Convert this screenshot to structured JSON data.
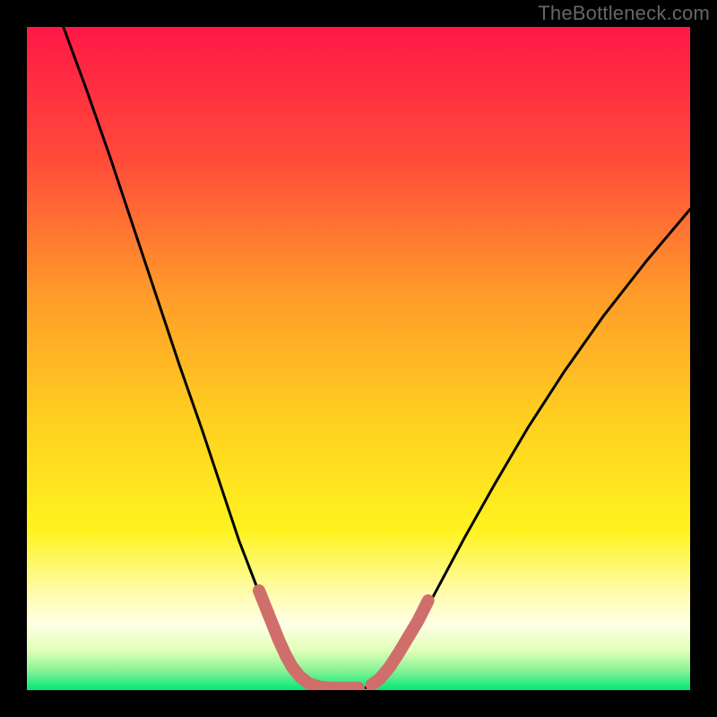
{
  "watermark": "TheBottleneck.com",
  "chart_data": {
    "type": "line",
    "title": "",
    "xlabel": "",
    "ylabel": "",
    "xlim": [
      0,
      1
    ],
    "ylim": [
      0,
      1
    ],
    "gradient_colors": {
      "top": "#ff1846",
      "upper_mid": "#ff8a2a",
      "mid": "#ffe81f",
      "lower_mid": "#f8fe90",
      "band_pale": "#ffffe6",
      "bottom": "#00e878"
    },
    "series": [
      {
        "name": "bottleneck-curve",
        "stroke": "#000000",
        "stroke_width": 3,
        "points": [
          {
            "x": 0.055,
            "y": 1.0
          },
          {
            "x": 0.09,
            "y": 0.905
          },
          {
            "x": 0.125,
            "y": 0.805
          },
          {
            "x": 0.16,
            "y": 0.7
          },
          {
            "x": 0.195,
            "y": 0.595
          },
          {
            "x": 0.23,
            "y": 0.49
          },
          {
            "x": 0.265,
            "y": 0.39
          },
          {
            "x": 0.295,
            "y": 0.3
          },
          {
            "x": 0.32,
            "y": 0.225
          },
          {
            "x": 0.345,
            "y": 0.16
          },
          {
            "x": 0.365,
            "y": 0.105
          },
          {
            "x": 0.382,
            "y": 0.062
          },
          {
            "x": 0.398,
            "y": 0.032
          },
          {
            "x": 0.415,
            "y": 0.012
          },
          {
            "x": 0.435,
            "y": 0.004
          },
          {
            "x": 0.46,
            "y": 0.002
          },
          {
            "x": 0.49,
            "y": 0.002
          },
          {
            "x": 0.515,
            "y": 0.004
          },
          {
            "x": 0.533,
            "y": 0.014
          },
          {
            "x": 0.555,
            "y": 0.04
          },
          {
            "x": 0.585,
            "y": 0.09
          },
          {
            "x": 0.62,
            "y": 0.155
          },
          {
            "x": 0.66,
            "y": 0.23
          },
          {
            "x": 0.705,
            "y": 0.31
          },
          {
            "x": 0.755,
            "y": 0.395
          },
          {
            "x": 0.81,
            "y": 0.48
          },
          {
            "x": 0.87,
            "y": 0.565
          },
          {
            "x": 0.935,
            "y": 0.648
          },
          {
            "x": 1.0,
            "y": 0.725
          }
        ]
      },
      {
        "name": "highlight-markers-left",
        "stroke": "#cf6e6b",
        "marker_radius": 7,
        "points": [
          {
            "x": 0.35,
            "y": 0.15
          },
          {
            "x": 0.36,
            "y": 0.125
          },
          {
            "x": 0.37,
            "y": 0.1
          },
          {
            "x": 0.38,
            "y": 0.075
          },
          {
            "x": 0.39,
            "y": 0.053
          },
          {
            "x": 0.4,
            "y": 0.035
          },
          {
            "x": 0.412,
            "y": 0.02
          },
          {
            "x": 0.425,
            "y": 0.01
          },
          {
            "x": 0.44,
            "y": 0.005
          },
          {
            "x": 0.46,
            "y": 0.003
          },
          {
            "x": 0.48,
            "y": 0.003
          },
          {
            "x": 0.5,
            "y": 0.003
          }
        ]
      },
      {
        "name": "highlight-markers-right",
        "stroke": "#cf6e6b",
        "marker_radius": 7,
        "points": [
          {
            "x": 0.52,
            "y": 0.008
          },
          {
            "x": 0.533,
            "y": 0.018
          },
          {
            "x": 0.547,
            "y": 0.035
          },
          {
            "x": 0.56,
            "y": 0.055
          },
          {
            "x": 0.575,
            "y": 0.08
          },
          {
            "x": 0.59,
            "y": 0.105
          },
          {
            "x": 0.605,
            "y": 0.135
          }
        ]
      }
    ]
  }
}
